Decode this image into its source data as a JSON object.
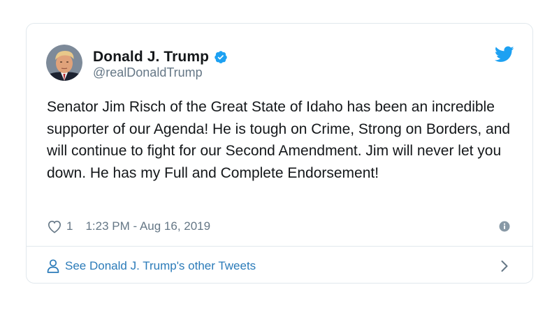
{
  "tweet": {
    "author": {
      "name": "Donald J. Trump",
      "handle": "@realDonaldTrump",
      "verified": true,
      "avatar_icon": "profile-photo"
    },
    "text": "Senator Jim Risch of the Great State of Idaho has been an incredible supporter of our Agenda! He is tough on Crime, Strong on Borders, and will continue to fight for our Second Amendment. Jim will never let you down. He has my Full and Complete Endorsement!",
    "likes": "1",
    "timestamp": "1:23 PM - Aug 16, 2019",
    "icons": {
      "brand": "twitter-bird-icon",
      "verified": "verified-badge-icon",
      "like": "heart-icon",
      "info": "info-icon",
      "profile": "user-icon",
      "more": "chevron-right-icon"
    }
  },
  "footer": {
    "link_label": "See Donald J. Trump's other Tweets"
  },
  "colors": {
    "accent": "#1da1f2",
    "link": "#2b7bb9",
    "secondary_text": "#657786",
    "border": "#e1e8ed"
  }
}
